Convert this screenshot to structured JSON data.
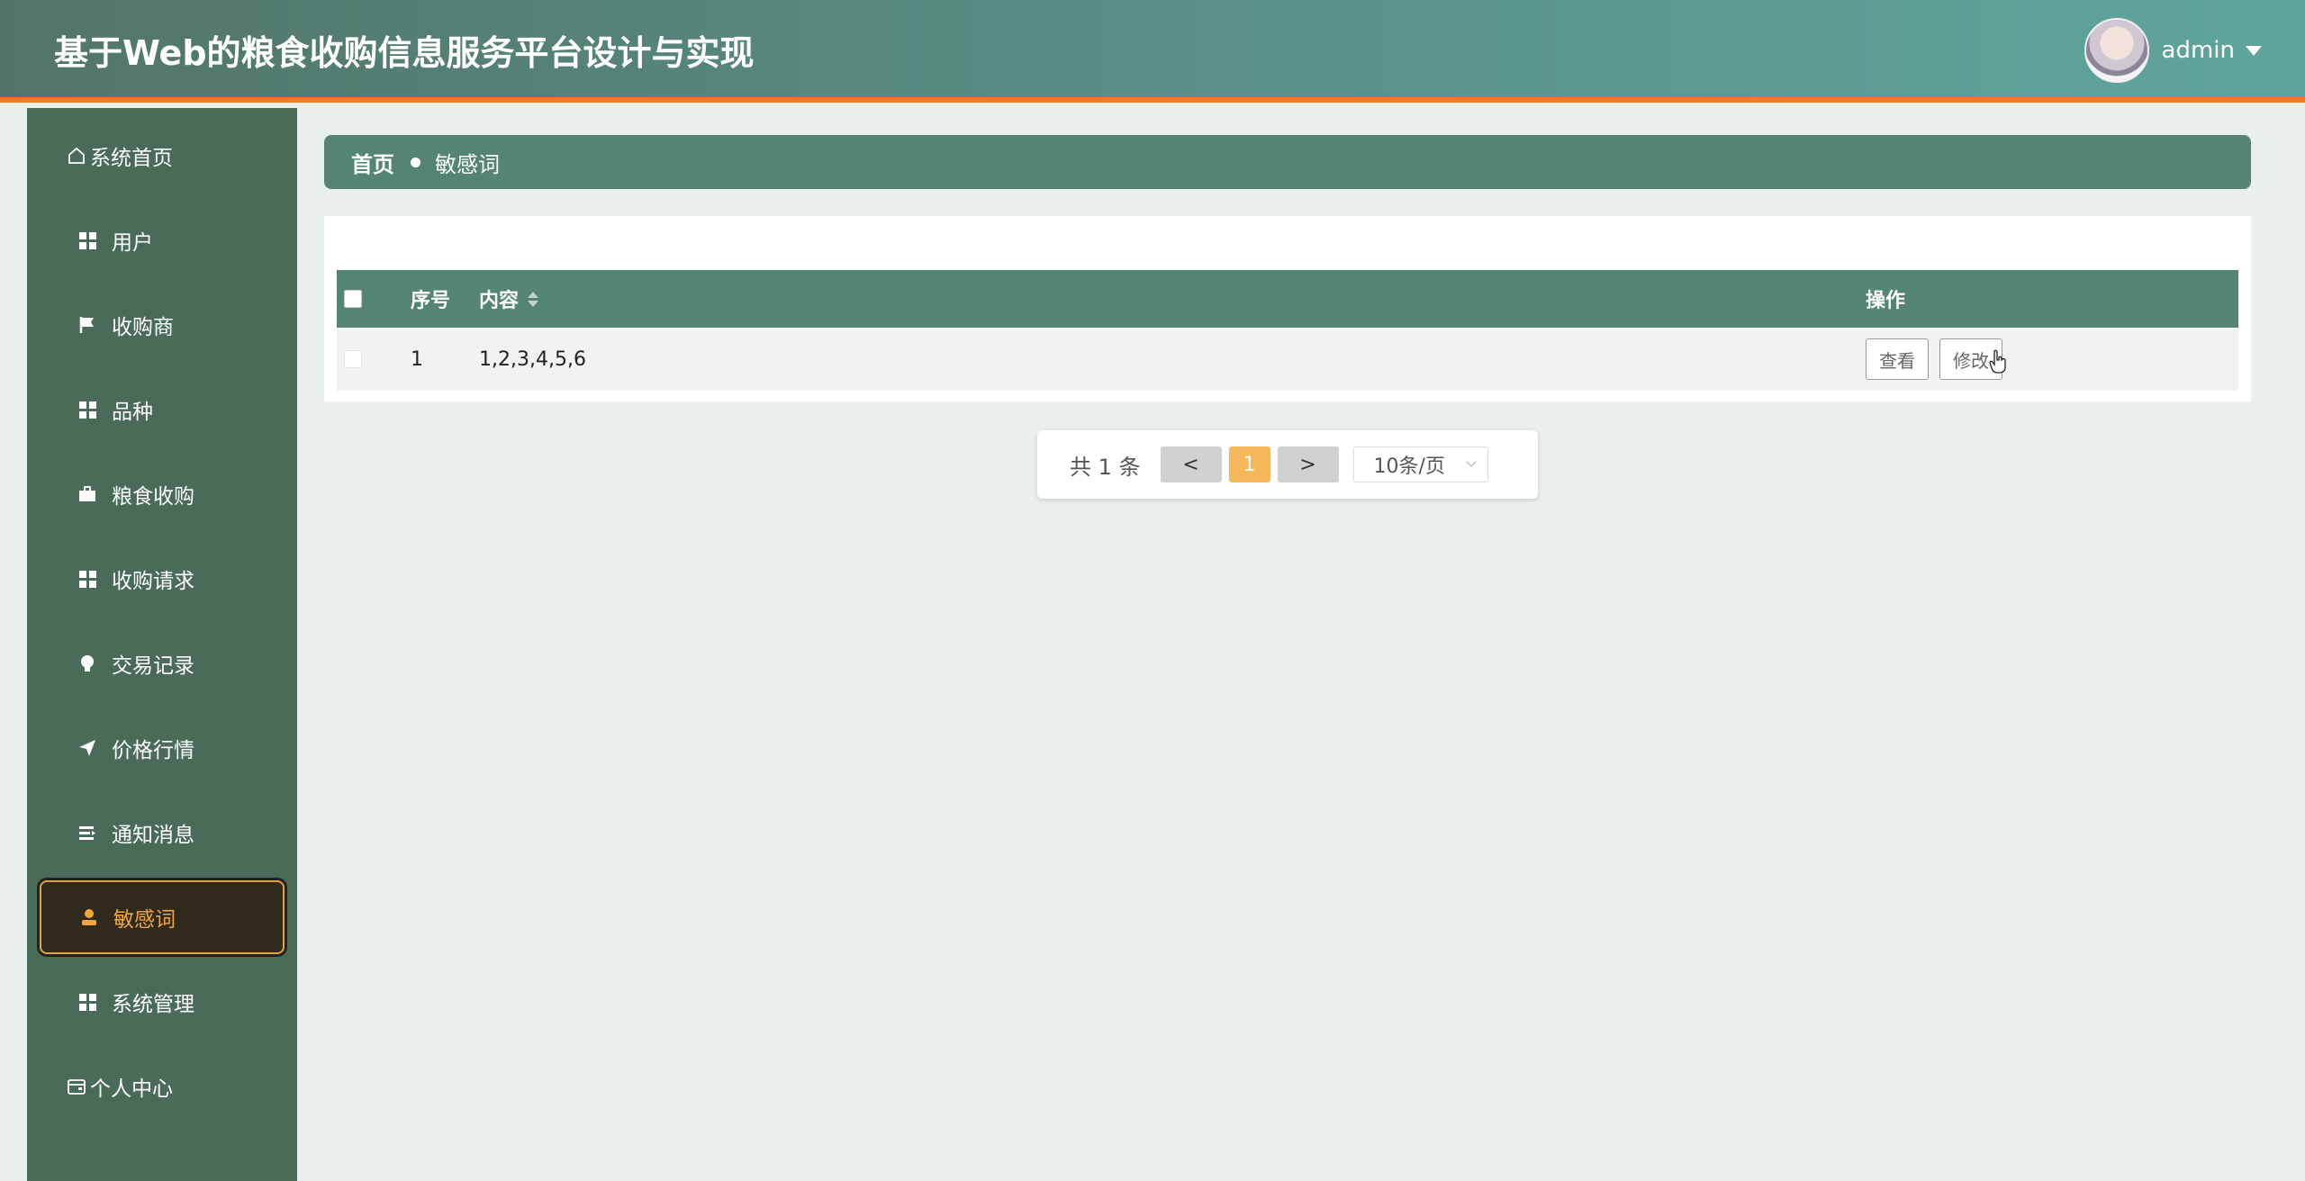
{
  "header": {
    "title": "基于Web的粮食收购信息服务平台设计与实现",
    "user": "admin"
  },
  "sidebar": {
    "items": [
      {
        "label": "系统首页",
        "icon": "home-icon"
      },
      {
        "label": "用户",
        "icon": "grid-icon"
      },
      {
        "label": "收购商",
        "icon": "flag-icon"
      },
      {
        "label": "品种",
        "icon": "grid-icon"
      },
      {
        "label": "粮食收购",
        "icon": "briefcase-icon"
      },
      {
        "label": "收购请求",
        "icon": "grid-icon"
      },
      {
        "label": "交易记录",
        "icon": "bulb-icon"
      },
      {
        "label": "价格行情",
        "icon": "send-icon"
      },
      {
        "label": "通知消息",
        "icon": "list-icon"
      },
      {
        "label": "敏感词",
        "icon": "user-icon",
        "active": true
      },
      {
        "label": "系统管理",
        "icon": "grid-icon"
      },
      {
        "label": "个人中心",
        "icon": "wallet-icon"
      }
    ]
  },
  "breadcrumb": {
    "home": "首页",
    "current": "敏感词"
  },
  "table": {
    "headers": {
      "index": "序号",
      "content": "内容",
      "actions": "操作"
    },
    "rows": [
      {
        "index": "1",
        "content": "1,2,3,4,5,6",
        "view": "查看",
        "edit": "修改"
      }
    ]
  },
  "pagination": {
    "total": "共 1 条",
    "prev": "<",
    "page": "1",
    "next": ">",
    "page_size": "10条/页"
  },
  "colors": {
    "header_start": "#52756a",
    "header_end": "#5fa59c",
    "accent_line": "#f07d1c",
    "sidebar": "#4a6b57",
    "active_text": "#f3a53c",
    "table_header": "#548573",
    "current_page": "#f4b75a"
  }
}
